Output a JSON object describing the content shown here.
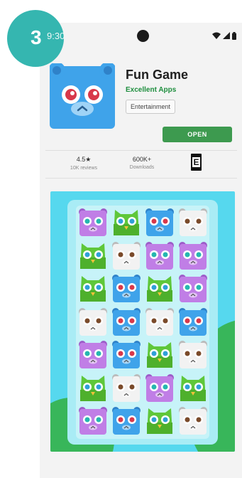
{
  "tutorial": {
    "step_number": "3"
  },
  "status_bar": {
    "time": "9:30"
  },
  "app": {
    "title": "Fun Game",
    "developer": "Excellent Apps",
    "category": "Entertainment",
    "install_button": "OPEN"
  },
  "stats": {
    "rating": {
      "value": "4.5★",
      "label": "10K reviews"
    },
    "downloads": {
      "value": "600K+",
      "label": "Downloads"
    },
    "content_rating": "E"
  },
  "colors": {
    "badge": "#35b6b0",
    "developer_text": "#1e8e3e",
    "open_button": "#3d9a4f",
    "screenshot_bg": "#56d8ee",
    "tile_purple": "#c07ee6",
    "tile_green": "#5fc73a",
    "tile_blue": "#3fa3ea",
    "tile_white": "#f2f2f2"
  },
  "game_board": {
    "tiles": [
      [
        "purple",
        "green",
        "blue",
        "white"
      ],
      [
        "green",
        "white",
        "purple",
        "purple"
      ],
      [
        "green",
        "blue",
        "green",
        "purple"
      ],
      [
        "white",
        "blue",
        "white",
        "blue"
      ],
      [
        "purple",
        "blue",
        "green",
        "white"
      ],
      [
        "green",
        "white",
        "purple",
        "green"
      ],
      [
        "purple",
        "blue",
        "green",
        "white"
      ]
    ]
  }
}
